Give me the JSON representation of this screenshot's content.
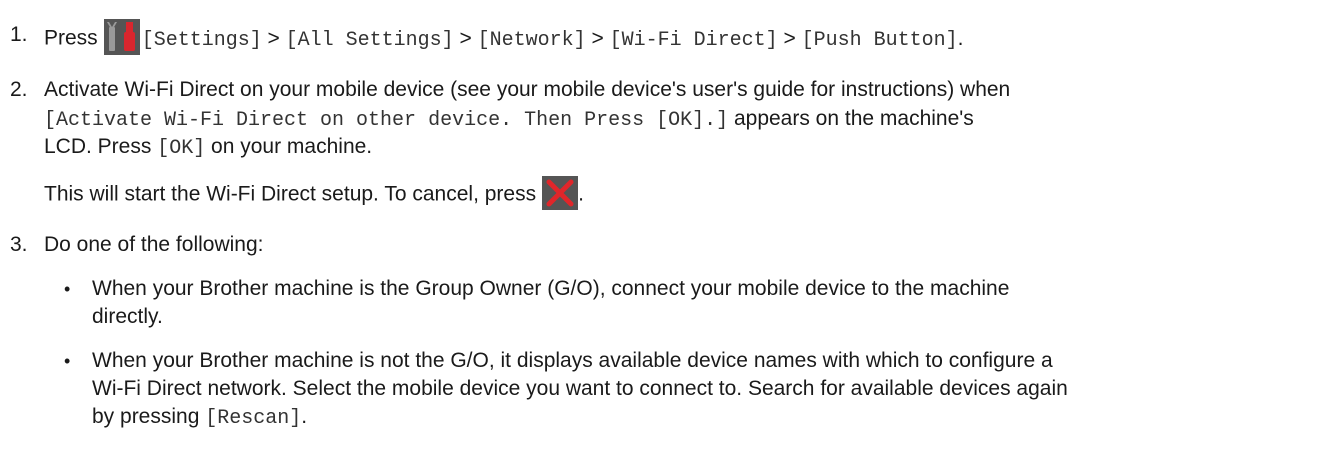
{
  "steps": [
    {
      "number": "1.",
      "lead": "Press",
      "icon": "settings-icon",
      "menu_path": [
        {
          "text": "[Settings]",
          "mono": true
        },
        {
          "text": " > ",
          "mono": false
        },
        {
          "text": "[All Settings]",
          "mono": true
        },
        {
          "text": " > ",
          "mono": false
        },
        {
          "text": "[Network]",
          "mono": true
        },
        {
          "text": " > ",
          "mono": false
        },
        {
          "text": "[Wi-Fi Direct]",
          "mono": true
        },
        {
          "text": " > ",
          "mono": false
        },
        {
          "text": "[Push Button]",
          "mono": true
        },
        {
          "text": ".",
          "mono": false
        }
      ]
    },
    {
      "number": "2.",
      "line1": "Activate Wi-Fi Direct on your mobile device (see your mobile device's user's guide for instructions) when",
      "line2_mono": "[Activate Wi-Fi Direct on other device. Then Press [OK].]",
      "line2_tail": " appears on the machine's",
      "line3_a": "LCD. Press ",
      "line3_mono": "[OK]",
      "line3_b": " on your machine.",
      "note": "This will start the Wi-Fi Direct setup. To cancel, press",
      "note_icon": "cancel-icon",
      "note_end": "."
    },
    {
      "number": "3.",
      "text": "Do one of the following:",
      "bullets": [
        {
          "line1": "When your Brother machine is the Group Owner (G/O), connect your mobile device to the machine",
          "line2": "directly."
        },
        {
          "line1": "When your Brother machine is not the G/O, it displays available device names with which to configure a",
          "line2": "Wi-Fi Direct network. Select the mobile device you want to connect to. Search for available devices again",
          "line3_a": "by pressing ",
          "line3_mono": "[Rescan]",
          "line3_b": "."
        }
      ]
    }
  ],
  "bullet_char": "•",
  "colors": {
    "text": "#1a1a1a",
    "icon_bg": "#555555",
    "cancel_x": "#e0262a",
    "settings_red": "#d9262e",
    "settings_gray": "#9a9a9a"
  }
}
